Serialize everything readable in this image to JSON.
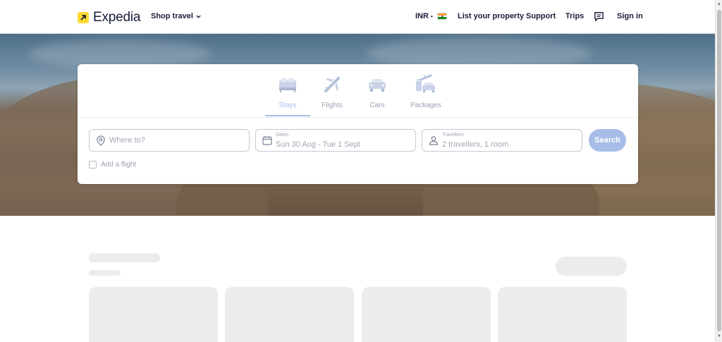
{
  "header": {
    "logo_text": "Expedia",
    "shop_travel": "Shop travel",
    "currency": "INR",
    "currency_sep": "•",
    "list_property": "List your property",
    "support": "Support",
    "trips": "Trips",
    "sign_in": "Sign in"
  },
  "tabs": [
    {
      "label": "Stays",
      "icon": "bed-icon",
      "active": true
    },
    {
      "label": "Flights",
      "icon": "plane-icon",
      "active": false
    },
    {
      "label": "Cars",
      "icon": "car-icon",
      "active": false
    },
    {
      "label": "Packages",
      "icon": "packages-icon",
      "active": false
    }
  ],
  "search": {
    "destination_placeholder": "Where to?",
    "dates_label": "Dates",
    "dates_value": "Sun 30 Aug - Tue 1 Sept",
    "travellers_label": "Travellers",
    "travellers_value": "2 travellers, 1 room",
    "search_button": "Search",
    "add_flight": "Add a flight"
  },
  "colors": {
    "brand_yellow": "#fddb32",
    "navy": "#191e3b",
    "accent_disabled": "#a7bde8",
    "skeleton": "#ebecee"
  }
}
